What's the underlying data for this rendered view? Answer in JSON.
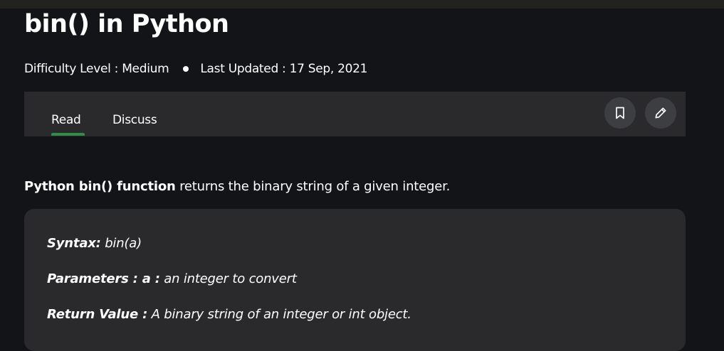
{
  "article": {
    "title": "bin() in Python",
    "difficulty": "Difficulty Level : Medium",
    "last_updated": "Last Updated : 17 Sep, 2021"
  },
  "tabs": {
    "read": "Read",
    "discuss": "Discuss",
    "active": "Read"
  },
  "actions": {
    "bookmark_icon": "bookmark-icon",
    "edit_icon": "pencil-icon"
  },
  "intro": {
    "bold": "Python bin() function",
    "rest": " returns the binary string of a given integer."
  },
  "syntax": {
    "syntax_label": "Syntax:",
    "syntax_value": " bin(a)",
    "params_label": "Parameters : a :",
    "params_value": " an integer to convert",
    "return_label": "Return Value :",
    "return_value": " A binary string of an integer or int object."
  },
  "colors": {
    "background": "#131417",
    "panel": "#2a2a2c",
    "accent": "#2f8d46"
  }
}
